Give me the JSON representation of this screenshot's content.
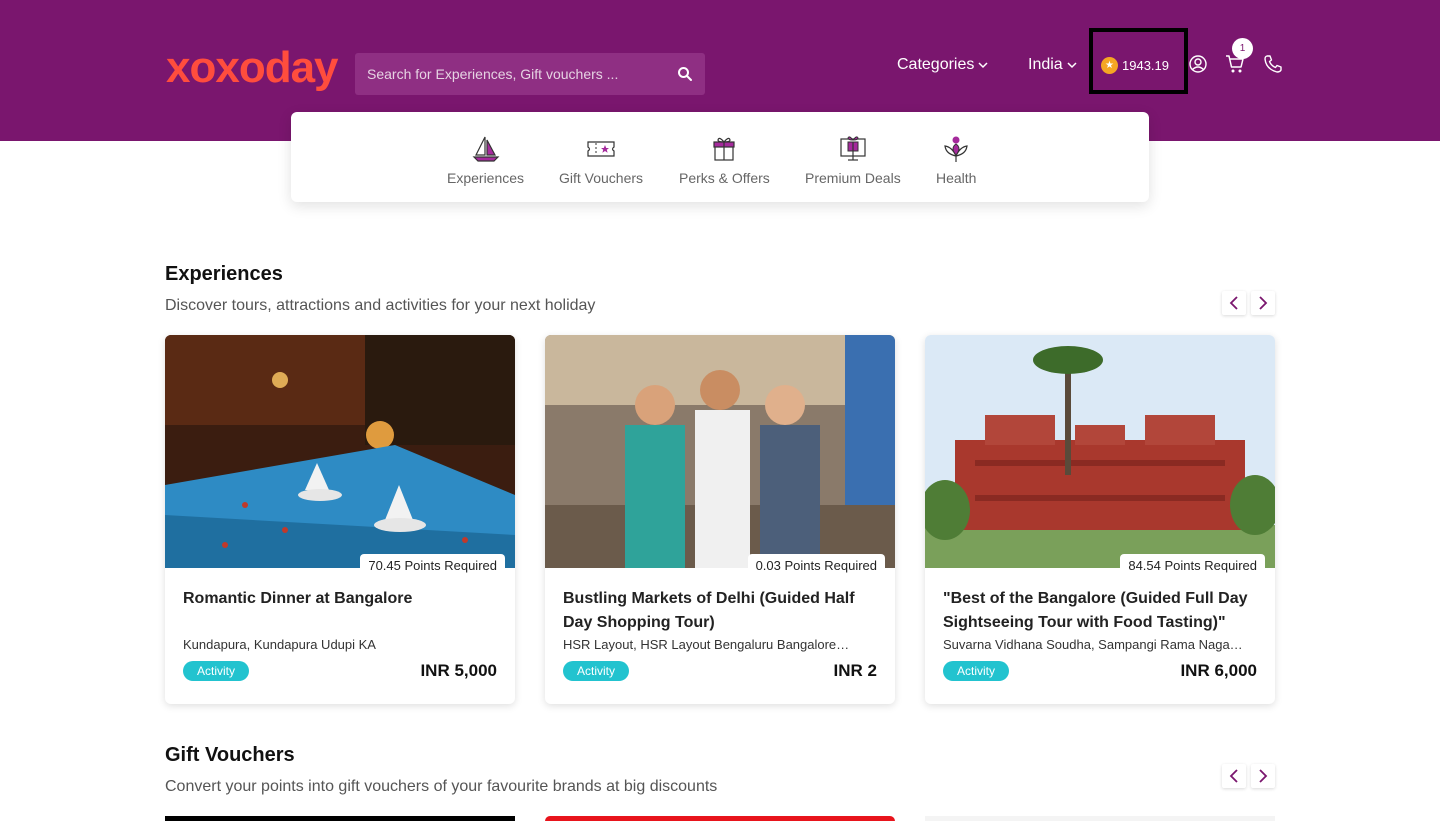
{
  "header": {
    "logo_text": "xoxoday",
    "search_placeholder": "Search for Experiences, Gift vouchers ...",
    "categories_label": "Categories",
    "country_label": "India",
    "points_balance": "1943.19",
    "cart_count": "1"
  },
  "category_tabs": [
    {
      "label": "Experiences",
      "icon": "sailboat-icon"
    },
    {
      "label": "Gift Vouchers",
      "icon": "ticket-icon"
    },
    {
      "label": "Perks & Offers",
      "icon": "gift-icon"
    },
    {
      "label": "Premium Deals",
      "icon": "gift-monitor-icon"
    },
    {
      "label": "Health",
      "icon": "lotus-icon"
    }
  ],
  "experiences": {
    "title": "Experiences",
    "subtitle": "Discover tours, attractions and activities for your next holiday",
    "cards": [
      {
        "points": "70.45 Points Required",
        "title": "Romantic Dinner at Bangalore",
        "location": "Kundapura, Kundapura Udupi KA",
        "tag": "Activity",
        "price": "INR 5,000"
      },
      {
        "points": "0.03 Points Required",
        "title": "Bustling Markets of Delhi (Guided Half Day Shopping Tour)",
        "location": "HSR Layout, HSR Layout Bengaluru Bangalore…",
        "tag": "Activity",
        "price": "INR 2"
      },
      {
        "points": "84.54 Points Required",
        "title": "\"Best of the Bangalore (Guided Full Day Sightseeing Tour with Food Tasting)\"",
        "location": "Suvarna Vidhana Soudha, Sampangi Rama Naga…",
        "tag": "Activity",
        "price": "INR 6,000"
      }
    ]
  },
  "gift_vouchers": {
    "title": "Gift Vouchers",
    "subtitle": "Convert your points into gift vouchers of your favourite brands at big discounts"
  },
  "colors": {
    "brand_purple": "#7a166e",
    "logo_orange": "#ff4d3d",
    "tag_teal": "#22c3cf",
    "coin": "#f5a623"
  }
}
